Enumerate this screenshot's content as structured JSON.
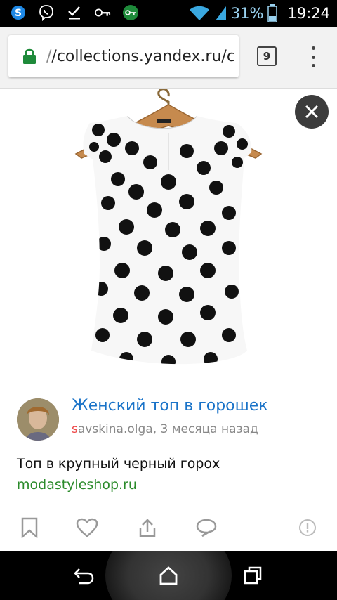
{
  "status_bar": {
    "icons": [
      "skype-icon",
      "viber-icon",
      "check-icon",
      "key-icon",
      "vpn-key-icon",
      "wifi-icon",
      "signal-icon",
      "battery-icon"
    ],
    "battery": "31%",
    "time": "19:24"
  },
  "browser": {
    "url_prefix": "/",
    "url": "/collections.yandex.ru/c",
    "tab_count": "9"
  },
  "post": {
    "title": "Женский топ в горошек",
    "author_first": "s",
    "author_rest": "avskina.olga",
    "time_ago": ", 3 месяца назад",
    "description": "Топ в крупный черный горох",
    "source": "modastyleshop.ru"
  },
  "colors": {
    "link_blue": "#1a73c8",
    "source_green": "#2a8a2a",
    "chrome_bg": "#f2f2f2"
  }
}
